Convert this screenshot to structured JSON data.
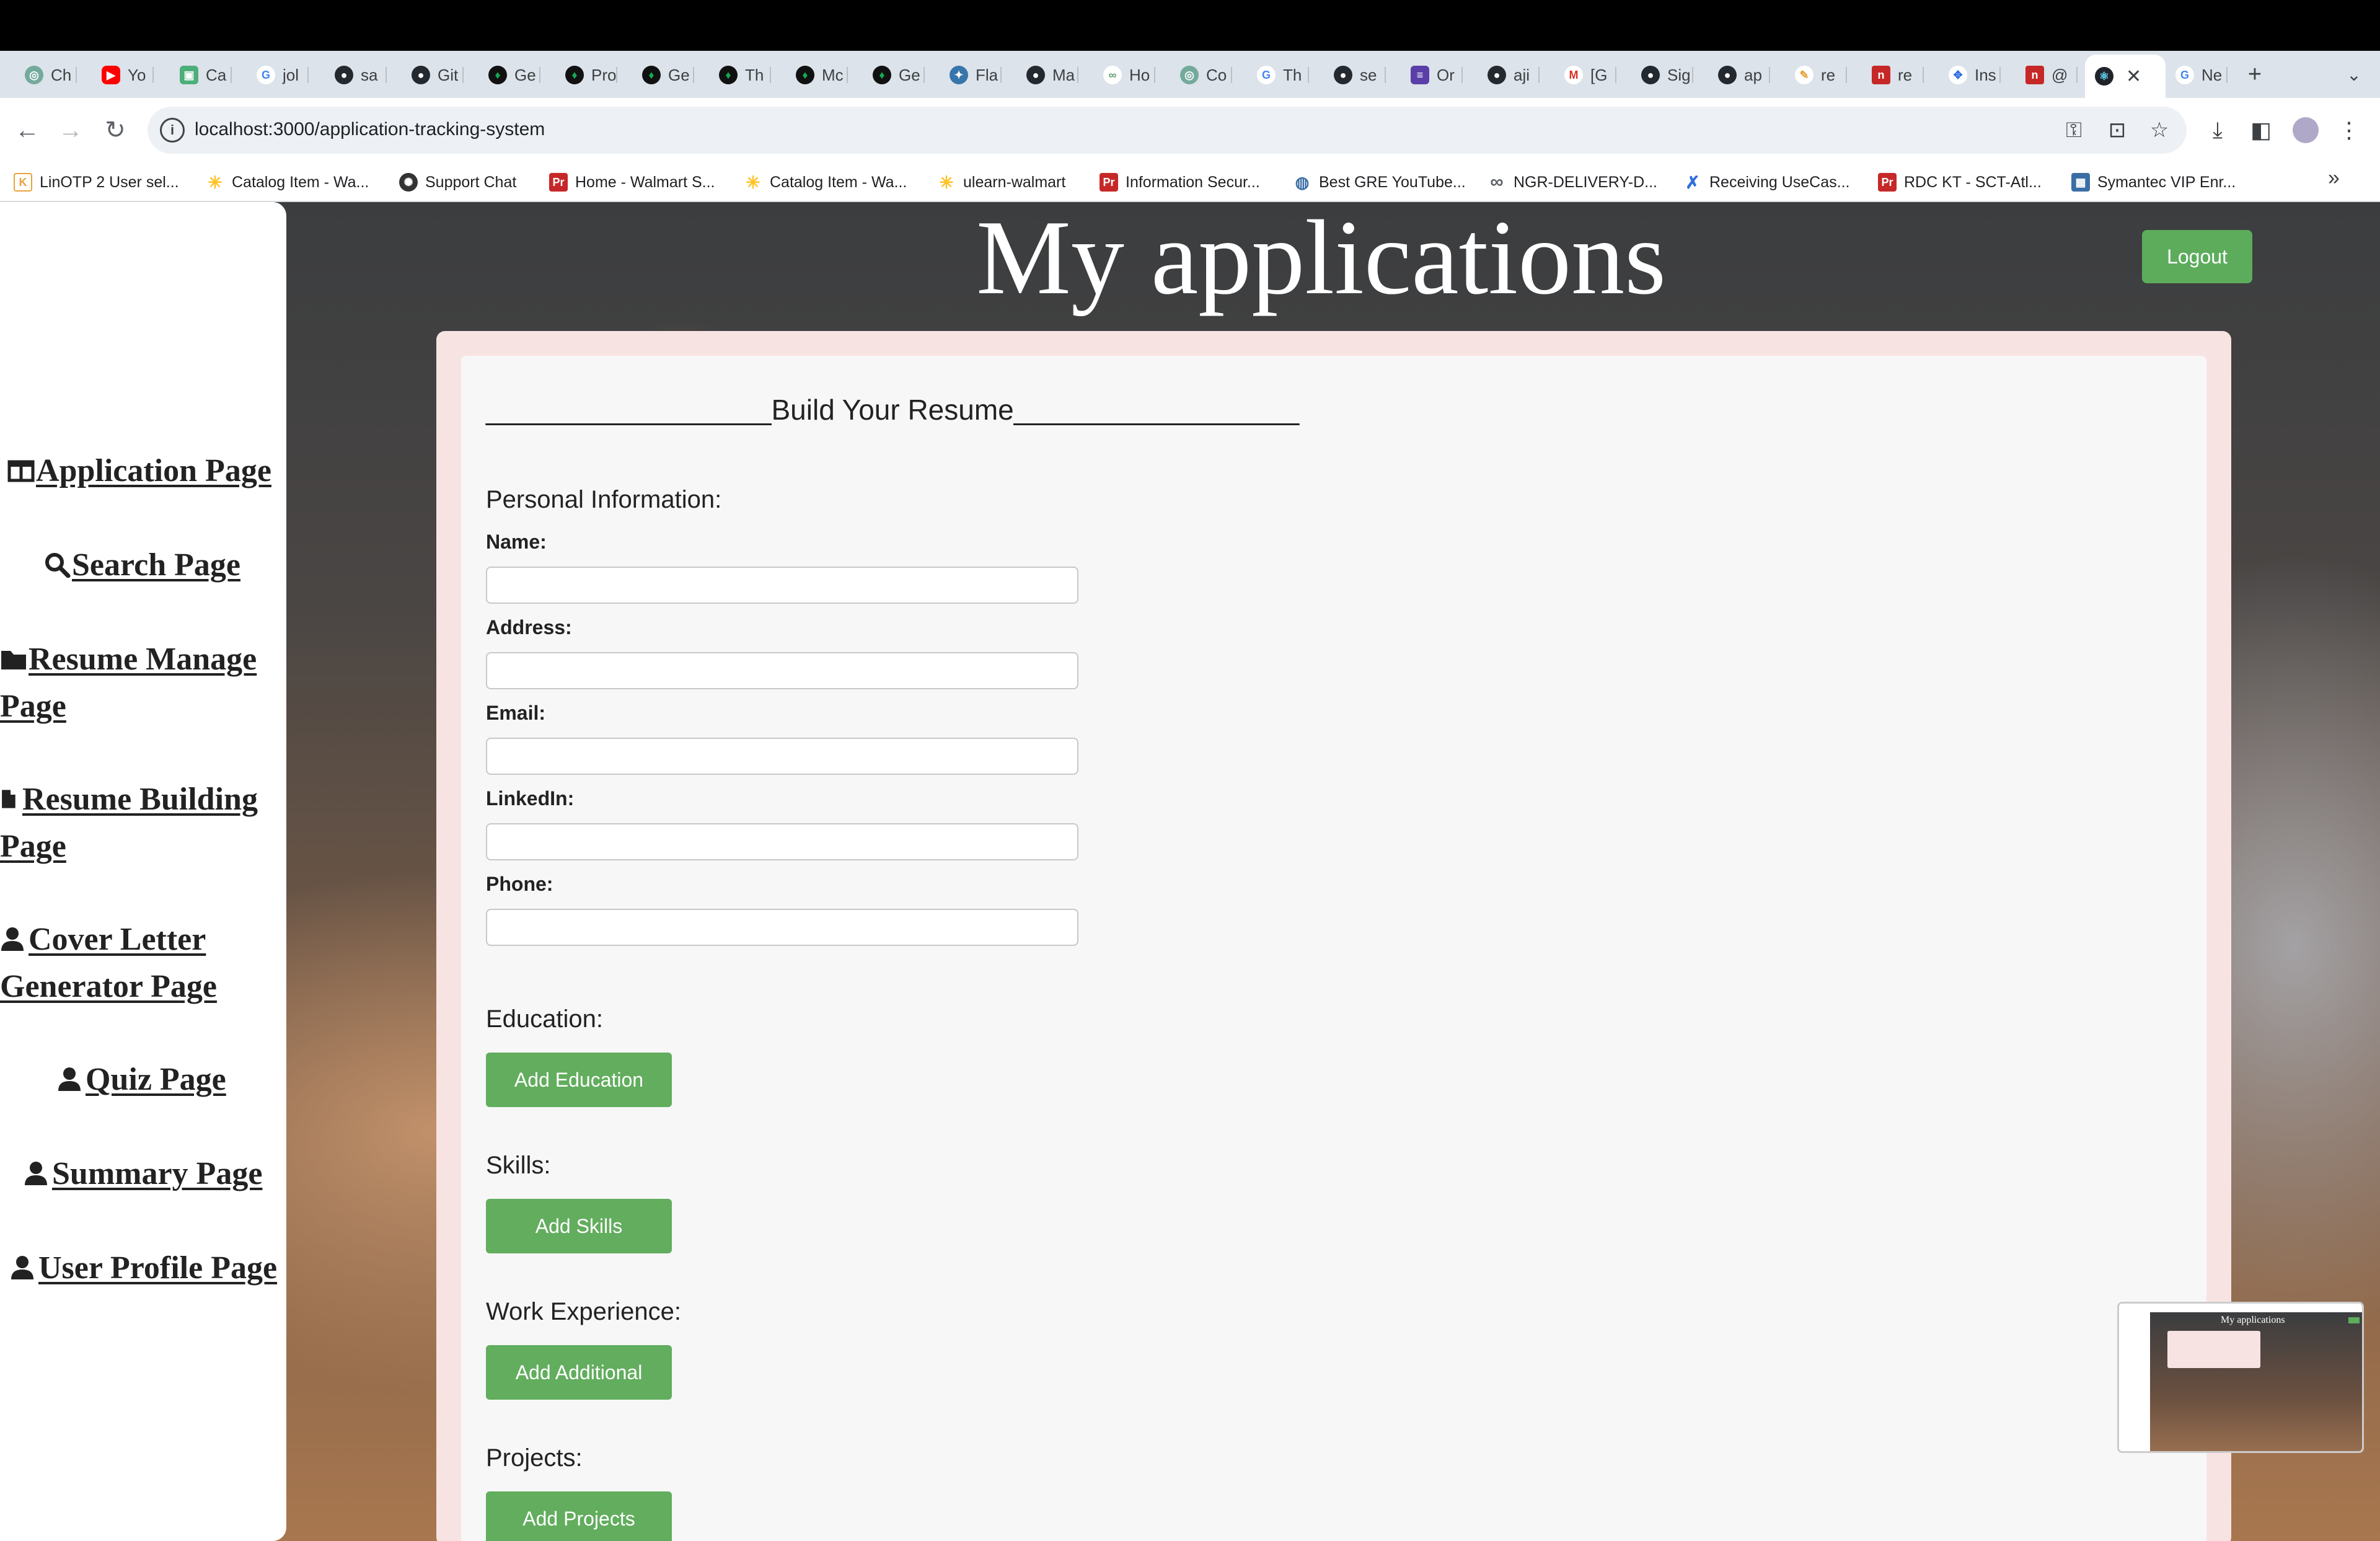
{
  "browser": {
    "tabs": [
      {
        "label": "Ch",
        "icon": "chatgpt-icon",
        "color": "#74aa9c"
      },
      {
        "label": "Yo",
        "icon": "youtube-icon",
        "color": "#ff0000"
      },
      {
        "label": "Ca",
        "icon": "canva-icon",
        "color": "#4caf7a"
      },
      {
        "label": "jol",
        "icon": "google-icon",
        "color": "#4285f4"
      },
      {
        "label": "sa",
        "icon": "github-icon",
        "color": "#24292f"
      },
      {
        "label": "Git",
        "icon": "github-icon",
        "color": "#24292f"
      },
      {
        "label": "Ge",
        "icon": "mongodb-icon",
        "color": "#13aa52"
      },
      {
        "label": "Pro",
        "icon": "mongodb-icon",
        "color": "#13aa52"
      },
      {
        "label": "Ge",
        "icon": "mongodb-icon",
        "color": "#13aa52"
      },
      {
        "label": "Th",
        "icon": "mongodb-icon",
        "color": "#13aa52"
      },
      {
        "label": "Mc",
        "icon": "mongodb-icon",
        "color": "#13aa52"
      },
      {
        "label": "Ge",
        "icon": "mongodb-icon",
        "color": "#13aa52"
      },
      {
        "label": "Fla",
        "icon": "python-icon",
        "color": "#3776ab"
      },
      {
        "label": "Ma",
        "icon": "github-icon",
        "color": "#24292f"
      },
      {
        "label": "Ho",
        "icon": "link-icon",
        "color": "#5f9e6e"
      },
      {
        "label": "Co",
        "icon": "chatgpt-icon",
        "color": "#74aa9c"
      },
      {
        "label": "Th",
        "icon": "google-icon",
        "color": "#4285f4"
      },
      {
        "label": "se",
        "icon": "github-icon",
        "color": "#24292f"
      },
      {
        "label": "Or",
        "icon": "list-icon",
        "color": "#5b3fa8"
      },
      {
        "label": "aji",
        "icon": "github-icon",
        "color": "#24292f"
      },
      {
        "label": "[G",
        "icon": "gmail-icon",
        "color": "#d93025"
      },
      {
        "label": "Sig",
        "icon": "github-icon",
        "color": "#24292f"
      },
      {
        "label": "ap",
        "icon": "github-icon",
        "color": "#24292f"
      },
      {
        "label": "re",
        "icon": "pen-icon",
        "color": "#e8a33d"
      },
      {
        "label": "re",
        "icon": "red-square-icon",
        "color": "#c62828"
      },
      {
        "label": "Ins",
        "icon": "puzzle-icon",
        "color": "#2f6fde"
      },
      {
        "label": "@",
        "icon": "red-square-icon",
        "color": "#c62828"
      },
      {
        "label": "",
        "icon": "react-icon",
        "color": "#20232a",
        "active": true
      },
      {
        "label": "Ne",
        "icon": "google-icon",
        "color": "#4285f4"
      }
    ],
    "url": "localhost:3000/application-tracking-system",
    "bookmarks": [
      {
        "label": "LinOTP 2 User sel...",
        "icon": "k-icon",
        "color": "#e8a33d"
      },
      {
        "label": "Catalog Item - Wa...",
        "icon": "walmart-spark-icon",
        "color": "#ffc220"
      },
      {
        "label": "Support Chat",
        "icon": "chat-icon",
        "color": "#333333"
      },
      {
        "label": "Home - Walmart S...",
        "icon": "pr-icon",
        "color": "#c62828"
      },
      {
        "label": "Catalog Item - Wa...",
        "icon": "walmart-spark-icon",
        "color": "#ffc220"
      },
      {
        "label": "ulearn-walmart",
        "icon": "walmart-spark-icon",
        "color": "#ffc220"
      },
      {
        "label": "Information Secur...",
        "icon": "pr-icon",
        "color": "#c62828"
      },
      {
        "label": "Best GRE YouTube...",
        "icon": "globe-icon",
        "color": "#3b6ea5"
      },
      {
        "label": "NGR-DELIVERY-D...",
        "icon": "infinity-icon",
        "color": "#5f6368"
      },
      {
        "label": "Receiving UseCas...",
        "icon": "confluence-icon",
        "color": "#2f6fde"
      },
      {
        "label": "RDC KT - SCT-Atl...",
        "icon": "pr-icon",
        "color": "#c62828"
      },
      {
        "label": "Symantec VIP Enr...",
        "icon": "symantec-icon",
        "color": "#3b6ea5"
      }
    ]
  },
  "sidebar": {
    "items": [
      {
        "label": "Application Page",
        "icon": "table-icon"
      },
      {
        "label": "Search Page",
        "icon": "search-icon"
      },
      {
        "label": "Resume Manage",
        "label2": "Page",
        "icon": "folder-icon"
      },
      {
        "label": "Resume Building",
        "label2": "Page",
        "icon": "file-icon"
      },
      {
        "label": "Cover Letter",
        "label2": "Generator Page",
        "icon": "user-icon"
      },
      {
        "label": "Quiz Page",
        "icon": "user-icon"
      },
      {
        "label": "Summary Page",
        "icon": "user-icon"
      },
      {
        "label": "User Profile Page",
        "icon": "user-icon"
      }
    ]
  },
  "header": {
    "title": "My applications",
    "logout_label": "Logout"
  },
  "resume_form": {
    "heading": "__________________Build Your Resume__________________",
    "personal_info_label": "Personal Information:",
    "fields": [
      {
        "label": "Name:",
        "value": ""
      },
      {
        "label": "Address:",
        "value": ""
      },
      {
        "label": "Email:",
        "value": ""
      },
      {
        "label": "LinkedIn:",
        "value": ""
      },
      {
        "label": "Phone:",
        "value": ""
      }
    ],
    "sections": [
      {
        "label": "Education:",
        "button": "Add Education"
      },
      {
        "label": "Skills:",
        "button": "Add Skills"
      },
      {
        "label": "Work Experience:",
        "button": "Add Additional"
      },
      {
        "label": "Projects:",
        "button": "Add Projects"
      }
    ]
  },
  "pip": {
    "title": "My applications"
  },
  "colors": {
    "accent_green": "#62ad5e",
    "card_pink": "#f8e3e3",
    "card_inner": "#f7f7f7"
  }
}
